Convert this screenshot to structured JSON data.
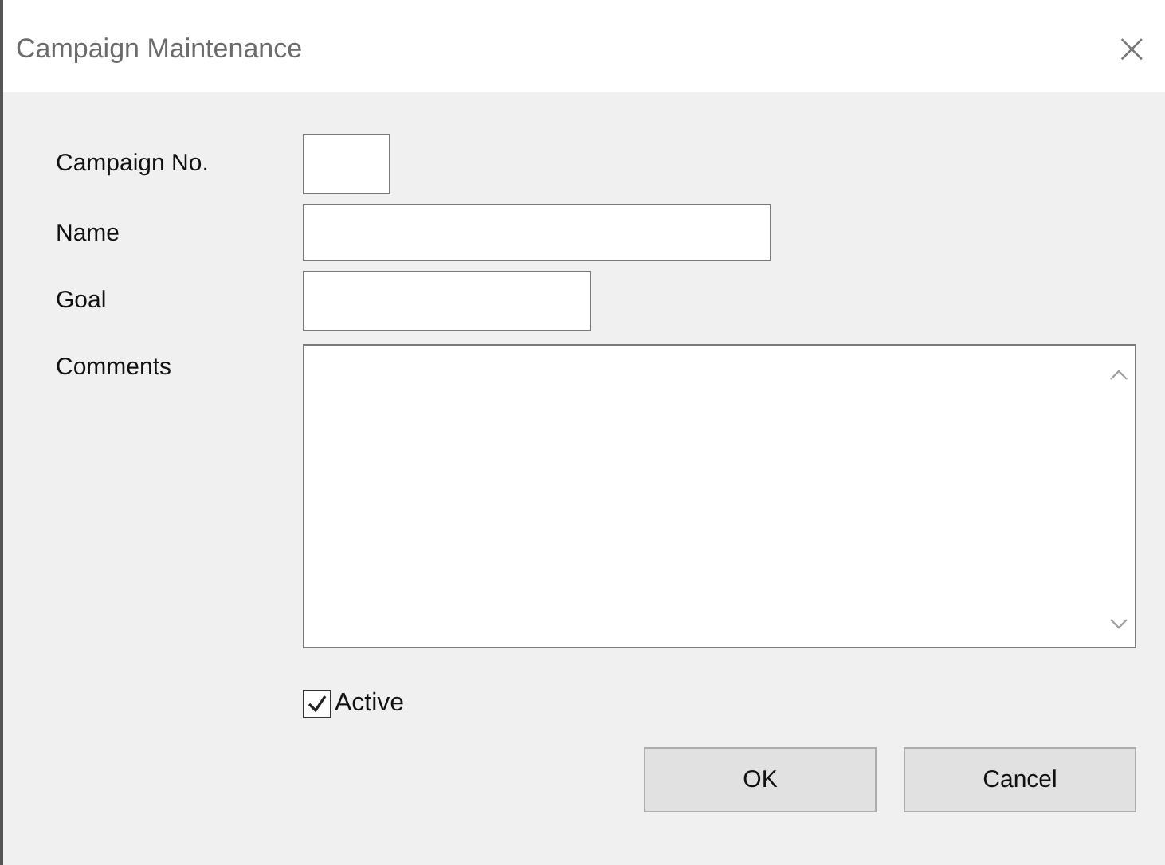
{
  "window": {
    "title": "Campaign Maintenance",
    "close": "×"
  },
  "fields": [
    {
      "label": "Campaign No.",
      "kind": "short"
    },
    {
      "label": "Name",
      "kind": "text"
    },
    {
      "label": "Goal",
      "kind": "medium"
    },
    {
      "label": "Comments",
      "kind": "memo"
    }
  ],
  "active": {
    "label": "Active",
    "checked": true
  },
  "buttons": [
    "OK",
    "Cancel"
  ]
}
